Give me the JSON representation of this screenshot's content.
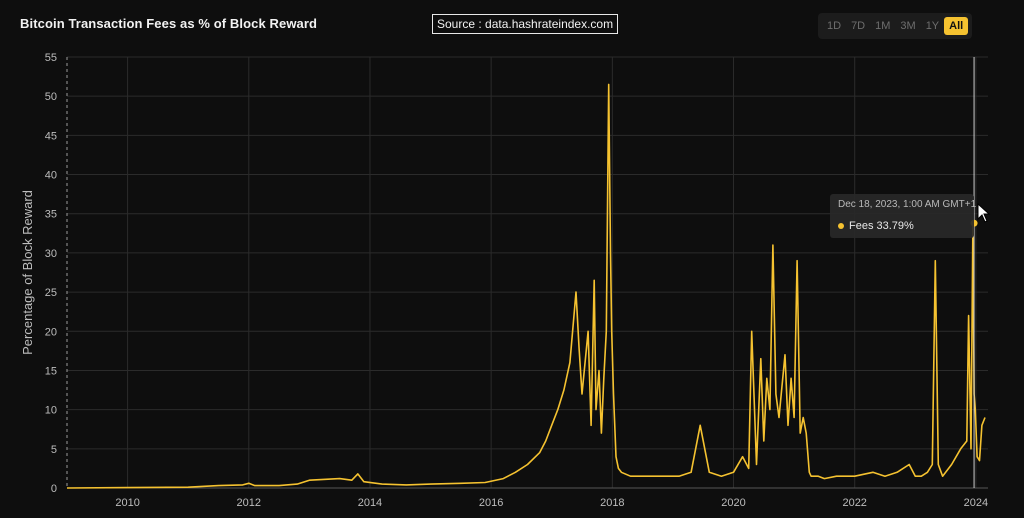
{
  "header": {
    "title": "Bitcoin Transaction Fees as % of Block Reward",
    "source": "Source : data.hashrateindex.com"
  },
  "range_buttons": [
    {
      "label": "1D",
      "active": false
    },
    {
      "label": "7D",
      "active": false
    },
    {
      "label": "1M",
      "active": false
    },
    {
      "label": "3M",
      "active": false
    },
    {
      "label": "1Y",
      "active": false
    },
    {
      "label": "All",
      "active": true
    }
  ],
  "tooltip": {
    "date": "Dec 18, 2023, 1:00 AM GMT+1",
    "series_label": "Fees 33.79%"
  },
  "colors": {
    "background": "#0e0e0e",
    "line": "#f5c230",
    "grid": "#2b2b2b",
    "accent": "#f5c230"
  },
  "chart_data": {
    "type": "line",
    "title": "Bitcoin Transaction Fees as % of Block Reward",
    "xlabel": "",
    "ylabel": "Percentage of Block Reward",
    "xlim": [
      2009.0,
      2024.2
    ],
    "ylim": [
      0,
      55
    ],
    "x_ticks": [
      2010,
      2012,
      2014,
      2016,
      2018,
      2020,
      2022,
      2024
    ],
    "y_ticks": [
      0,
      5,
      10,
      15,
      20,
      25,
      30,
      35,
      40,
      45,
      50,
      55
    ],
    "grid": true,
    "legend": "none",
    "series": [
      {
        "name": "Fees",
        "x": [
          2009.0,
          2010.0,
          2011.0,
          2011.5,
          2011.9,
          2012.0,
          2012.1,
          2012.5,
          2012.8,
          2013.0,
          2013.5,
          2013.7,
          2013.8,
          2013.9,
          2014.2,
          2014.6,
          2015.0,
          2015.5,
          2015.9,
          2016.2,
          2016.4,
          2016.6,
          2016.8,
          2016.9,
          2017.0,
          2017.1,
          2017.2,
          2017.3,
          2017.4,
          2017.45,
          2017.5,
          2017.6,
          2017.65,
          2017.7,
          2017.73,
          2017.78,
          2017.82,
          2017.86,
          2017.9,
          2017.94,
          2017.97,
          2017.99,
          2018.02,
          2018.06,
          2018.1,
          2018.15,
          2018.3,
          2018.6,
          2018.9,
          2019.1,
          2019.3,
          2019.45,
          2019.6,
          2019.8,
          2020.0,
          2020.15,
          2020.25,
          2020.3,
          2020.38,
          2020.45,
          2020.5,
          2020.55,
          2020.6,
          2020.65,
          2020.7,
          2020.75,
          2020.8,
          2020.85,
          2020.9,
          2020.95,
          2021.0,
          2021.05,
          2021.1,
          2021.15,
          2021.2,
          2021.25,
          2021.28,
          2021.32,
          2021.35,
          2021.4,
          2021.5,
          2021.7,
          2022.0,
          2022.3,
          2022.5,
          2022.7,
          2022.9,
          2023.0,
          2023.1,
          2023.2,
          2023.28,
          2023.33,
          2023.38,
          2023.45,
          2023.6,
          2023.75,
          2023.85,
          2023.88,
          2023.92,
          2023.95,
          2023.97,
          2023.99,
          2024.02,
          2024.06,
          2024.1,
          2024.15
        ],
        "values": [
          0.0,
          0.05,
          0.1,
          0.3,
          0.4,
          0.6,
          0.3,
          0.3,
          0.5,
          1.0,
          1.2,
          1.0,
          1.8,
          0.8,
          0.5,
          0.4,
          0.5,
          0.6,
          0.7,
          1.2,
          2.0,
          3.0,
          4.5,
          6.0,
          8.0,
          10.0,
          12.5,
          16.0,
          25.0,
          18.0,
          12.0,
          20.0,
          8.0,
          26.5,
          10.0,
          15.0,
          7.0,
          14.0,
          20.0,
          51.5,
          30.0,
          20.0,
          12.0,
          4.0,
          2.5,
          2.0,
          1.5,
          1.5,
          1.5,
          1.5,
          2.0,
          8.0,
          2.0,
          1.5,
          2.0,
          4.0,
          2.5,
          20.0,
          3.0,
          16.5,
          6.0,
          14.0,
          10.0,
          31.0,
          12.0,
          9.0,
          13.0,
          17.0,
          8.0,
          14.0,
          9.0,
          29.0,
          7.0,
          9.0,
          7.0,
          2.0,
          1.5,
          1.5,
          1.5,
          1.5,
          1.2,
          1.5,
          1.5,
          2.0,
          1.5,
          2.0,
          3.0,
          1.5,
          1.5,
          2.0,
          3.0,
          29.0,
          3.0,
          1.5,
          3.0,
          5.0,
          6.0,
          22.0,
          5.0,
          33.79,
          12.0,
          10.0,
          4.0,
          3.5,
          8.0,
          9.0
        ]
      }
    ]
  }
}
